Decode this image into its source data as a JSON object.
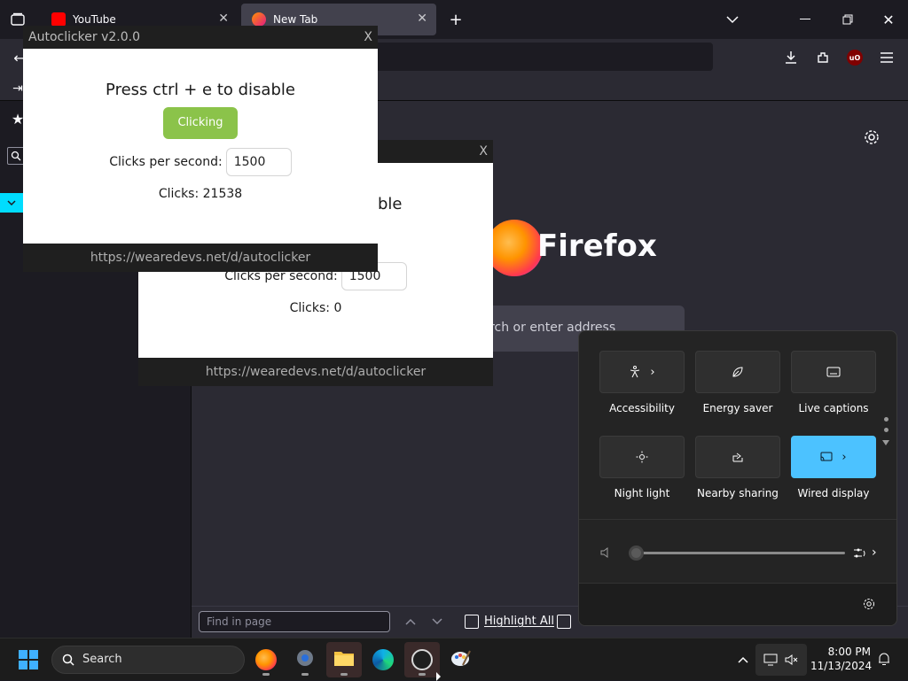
{
  "browser": {
    "tabs": [
      {
        "title": "YouTube",
        "active": false
      },
      {
        "title": "New Tab",
        "active": true
      }
    ],
    "brand_name": "Firefox",
    "search_placeholder": "Search or enter address",
    "find_placeholder": "Find in page",
    "highlight_all_label": "Highlight All",
    "colors": {
      "chrome": "#1c1b22",
      "toolbar": "#2b2a33",
      "accent_sidebar": "#00ddff"
    }
  },
  "autoclicker_front": {
    "title": "Autoclicker v2.0.0",
    "close_label": "X",
    "heading": "Press ctrl + e to disable",
    "button_label": "Clicking",
    "cps_label": "Clicks per second:",
    "cps_value": "1500",
    "clicks_text": "Clicks: 21538",
    "footer_url": "https://wearedevs.net/d/autoclicker",
    "button_color": "#8bc34a"
  },
  "autoclicker_back": {
    "close_label": "X",
    "heading_partial": "ble",
    "cps_label": "Clicks per second:",
    "cps_value": "1500",
    "clicks_text": "Clicks: 0",
    "footer_url": "https://wearedevs.net/d/autoclicker"
  },
  "quick_settings": {
    "tiles": [
      {
        "label": "Accessibility",
        "icon": "accessibility-icon",
        "active": false,
        "chevron": true
      },
      {
        "label": "Energy saver",
        "icon": "leaf-icon",
        "active": false,
        "chevron": false
      },
      {
        "label": "Live captions",
        "icon": "captions-icon",
        "active": false,
        "chevron": false
      },
      {
        "label": "Night light",
        "icon": "sun-icon",
        "active": false,
        "chevron": false
      },
      {
        "label": "Nearby sharing",
        "icon": "share-icon",
        "active": false,
        "chevron": false
      },
      {
        "label": "Wired display",
        "icon": "cast-icon",
        "active": true,
        "chevron": true
      }
    ],
    "volume_level": 0,
    "active_color": "#4cc2ff"
  },
  "taskbar": {
    "search_label": "Search",
    "time": "8:00 PM",
    "date": "11/13/2024",
    "apps": [
      "firefox-icon",
      "settings-icon",
      "file-explorer-icon",
      "edge-icon",
      "autoclicker-icon",
      "paint-icon"
    ]
  }
}
